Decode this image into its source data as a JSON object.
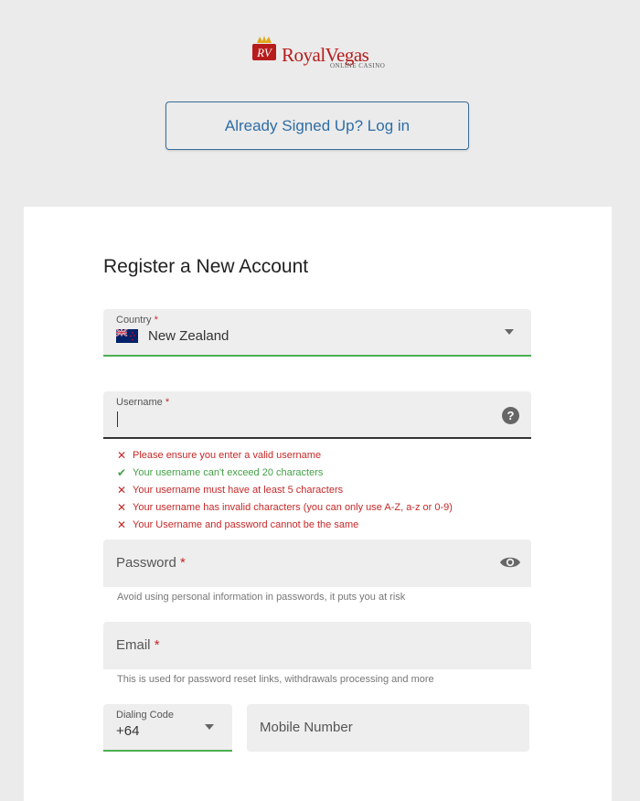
{
  "logo": {
    "brand": "RoyalVegas",
    "sub": "ONLINE CASINO",
    "mark": "RV"
  },
  "login_button": "Already Signed Up? Log in",
  "title": "Register a New Account",
  "country": {
    "label": "Country",
    "required": "*",
    "value": "New Zealand",
    "flag": "nz-flag-icon"
  },
  "username": {
    "label": "Username",
    "required": "*",
    "value": ""
  },
  "username_rules": [
    {
      "status": "fail",
      "text": "Please ensure you enter a valid username"
    },
    {
      "status": "pass",
      "text": "Your username can't exceed 20 characters"
    },
    {
      "status": "fail",
      "text": "Your username must have at least 5 characters"
    },
    {
      "status": "fail",
      "text": "Your username has invalid characters (you can only use A-Z, a-z or 0-9)"
    },
    {
      "status": "fail",
      "text": "Your Username and password cannot be the same"
    }
  ],
  "password": {
    "label": "Password",
    "required": "*",
    "hint": "Avoid using personal information in passwords, it puts you at risk"
  },
  "email": {
    "label": "Email",
    "required": "*",
    "hint": "This is used for password reset links, withdrawals processing and more"
  },
  "dialing": {
    "label": "Dialing Code",
    "value": "+64"
  },
  "mobile": {
    "placeholder": "Mobile Number"
  },
  "colors": {
    "success": "#4caf50",
    "error": "#c62828",
    "link": "#2e6da4",
    "brand": "#b71c1c"
  }
}
